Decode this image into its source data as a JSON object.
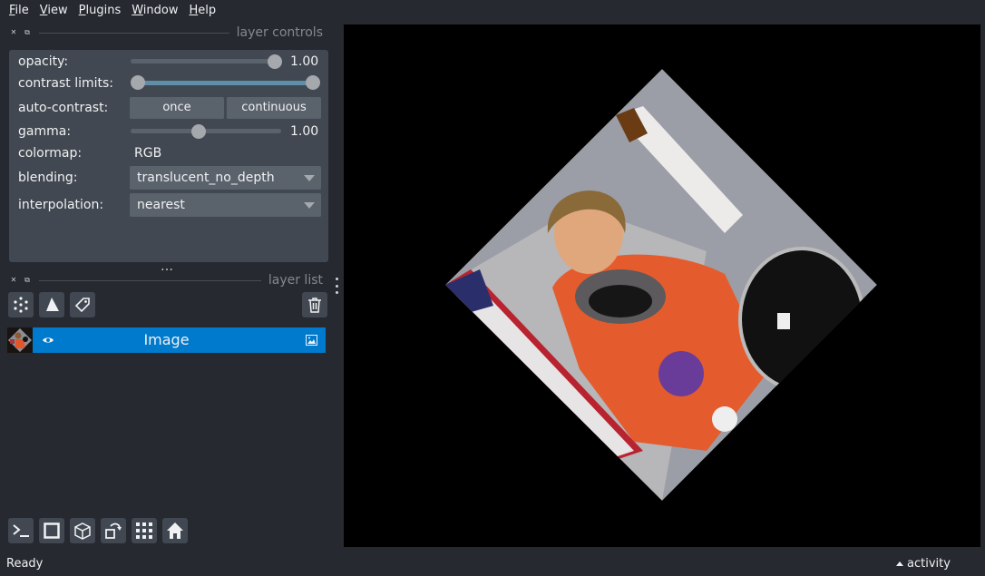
{
  "menu": {
    "file": {
      "mnemonic": "F",
      "rest": "ile"
    },
    "view": {
      "mnemonic": "V",
      "rest": "iew"
    },
    "plugins": {
      "mnemonic": "P",
      "rest": "lugins"
    },
    "window": {
      "mnemonic": "W",
      "rest": "indow"
    },
    "help": {
      "mnemonic": "H",
      "rest": "elp"
    }
  },
  "layer_controls": {
    "title": "layer controls",
    "opacity": {
      "label": "opacity:",
      "value": "1.00",
      "fraction": 1.0
    },
    "contrast_limits": {
      "label": "contrast limits:",
      "low_fraction": 0.0,
      "high_fraction": 1.0
    },
    "auto_contrast": {
      "label": "auto-contrast:",
      "once": "once",
      "continuous": "continuous"
    },
    "gamma": {
      "label": "gamma:",
      "value": "1.00",
      "fraction": 0.45
    },
    "colormap": {
      "label": "colormap:",
      "value": "RGB"
    },
    "blending": {
      "label": "blending:",
      "value": "translucent_no_depth"
    },
    "interpolation": {
      "label": "interpolation:",
      "value": "nearest"
    }
  },
  "splitter": "…",
  "layer_list": {
    "title": "layer list",
    "tools": [
      "points-icon",
      "shapes-icon",
      "labels-icon"
    ],
    "delete": "trash-icon",
    "layers": [
      {
        "name": "Image",
        "visible": true,
        "type_icon": "image-icon"
      }
    ]
  },
  "bottom_toolbar": [
    "console-icon",
    "ndisplay-icon",
    "3d-cube-icon",
    "roll-icon",
    "grid-icon",
    "home-icon"
  ],
  "status": {
    "text": "Ready",
    "activity": "activity"
  },
  "colors": {
    "background": "#262930",
    "panel": "#414851",
    "accent": "#007acc",
    "control": "#5a626c"
  }
}
